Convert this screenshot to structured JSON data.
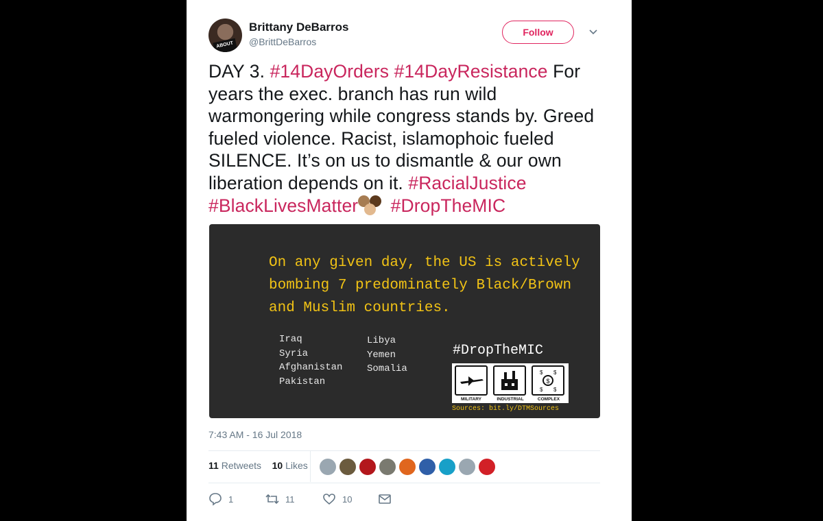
{
  "user": {
    "name": "Brittany DeBarros",
    "handle": "@BrittDeBarros",
    "avatar_text": "ABOUT FA"
  },
  "follow_label": "Follow",
  "tweet": {
    "p1": "DAY 3. ",
    "tag1": "#14DayOrders",
    "tag2": "#14DayResistance",
    "p2": " For years the exec. branch has run wild warmongering while congress stands by. Greed fueled violence. Racist, islamophoic fueled SILENCE. It’s on us to dismantle & our own liberation depends on it. ",
    "tag3": "#RacialJustice",
    "tag4": "#BlackLivesMatter",
    "tag5": "#DropTheMIC"
  },
  "media": {
    "headline": "On any given day, the US is actively bombing 7 predominately Black/Brown and Muslim countries.",
    "countries_left": [
      "Iraq",
      "Syria",
      "Afghanistan",
      "Pakistan"
    ],
    "countries_right": [
      "Libya",
      "Yemen",
      "Somalia"
    ],
    "hashtag": "#DropTheMIC",
    "mic_labels": [
      "MILITARY",
      "INDUSTRIAL",
      "COMPLEX"
    ],
    "sources": "Sources: bit.ly/DTMSources"
  },
  "timestamp": "7:43 AM - 16 Jul 2018",
  "stats": {
    "retweets_count": "11",
    "retweets_label": "Retweets",
    "likes_count": "10",
    "likes_label": "Likes"
  },
  "liker_colors": [
    "#9aa7b1",
    "#6b5b3e",
    "#b3171c",
    "#7a7a70",
    "#e0661e",
    "#2f5fa8",
    "#18a0c8",
    "#9aa7b1",
    "#d22027"
  ],
  "actions": {
    "replies": "1",
    "retweets": "11",
    "likes": "10"
  },
  "colors": {
    "accent": "#e0245e",
    "hashtag": "#c9265d",
    "media_bg": "#2b2b2b",
    "headline": "#f2c315"
  }
}
